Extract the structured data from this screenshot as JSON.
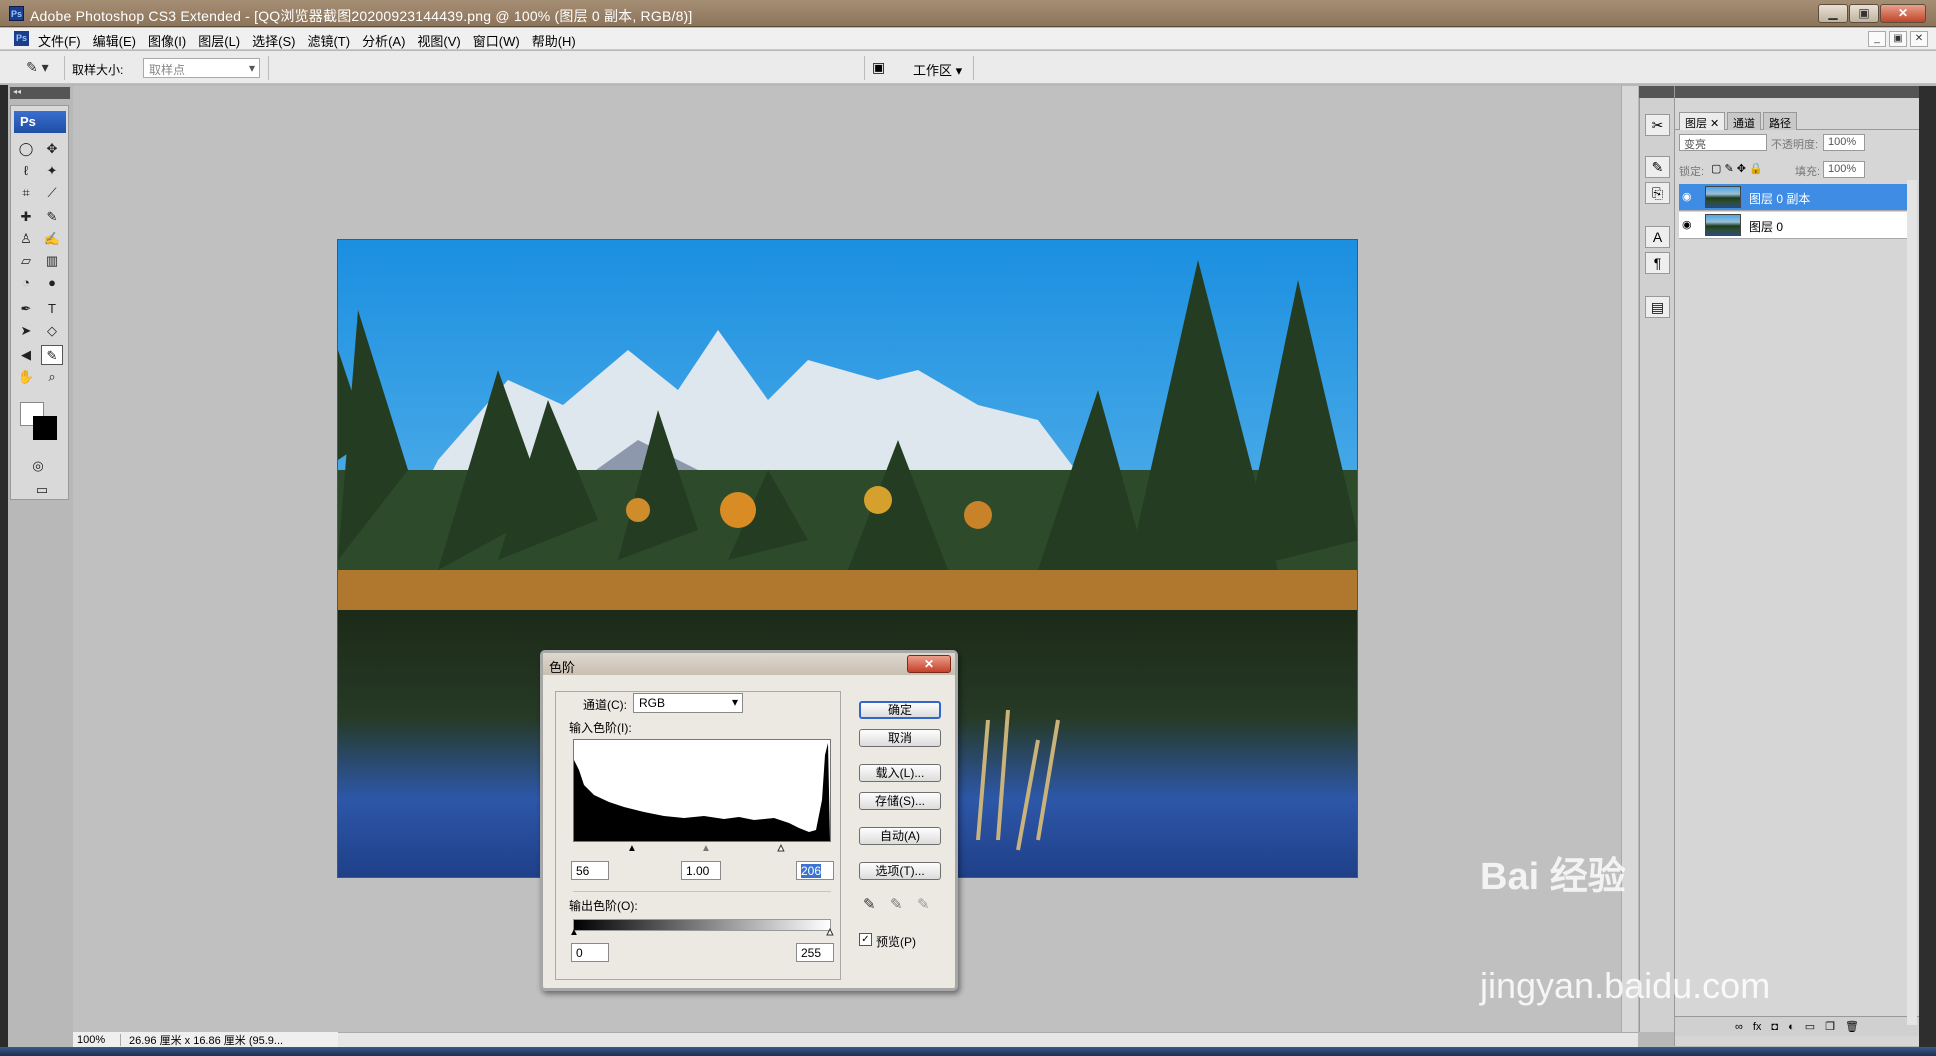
{
  "window": {
    "title": "Adobe Photoshop CS3 Extended - [QQ浏览器截图20200923144439.png @ 100% (图层 0 副本, RGB/8)]",
    "app_icon": "Ps"
  },
  "menubar": {
    "items": [
      "文件(F)",
      "编辑(E)",
      "图像(I)",
      "图层(L)",
      "选择(S)",
      "滤镜(T)",
      "分析(A)",
      "视图(V)",
      "窗口(W)",
      "帮助(H)"
    ]
  },
  "options_bar": {
    "sample_size_label": "取样大小:",
    "sample_size_value": "取样点",
    "workspace_label": "工作区 ▾"
  },
  "toolbox": {
    "logo": "Ps"
  },
  "status": {
    "zoom": "100%",
    "doc_info": "26.96 厘米 x 16.86 厘米 (95.9..."
  },
  "levels_dialog": {
    "title": "色阶",
    "channel_label": "通道(C):",
    "channel_value": "RGB",
    "input_label": "输入色阶(I):",
    "input_black": "56",
    "input_gamma": "1.00",
    "input_white": "206",
    "output_label": "输出色阶(O):",
    "output_black": "0",
    "output_white": "255",
    "buttons": {
      "ok": "确定",
      "cancel": "取消",
      "load": "载入(L)...",
      "save": "存储(S)...",
      "auto": "自动(A)",
      "options": "选项(T)..."
    },
    "preview_label": "预览(P)",
    "preview_checked": true,
    "close": "✕"
  },
  "layers_panel": {
    "tabs": [
      "图层",
      "通道",
      "路径"
    ],
    "blend_mode": "变亮",
    "opacity_label": "不透明度:",
    "opacity_value": "100%",
    "lock_label": "锁定:",
    "fill_label": "填充:",
    "fill_value": "100%",
    "layers": [
      {
        "name": "图层 0 副本",
        "selected": true
      },
      {
        "name": "图层 0",
        "selected": false
      }
    ]
  },
  "watermark": {
    "brand": "Bai 经验",
    "url": "jingyan.baidu.com"
  }
}
